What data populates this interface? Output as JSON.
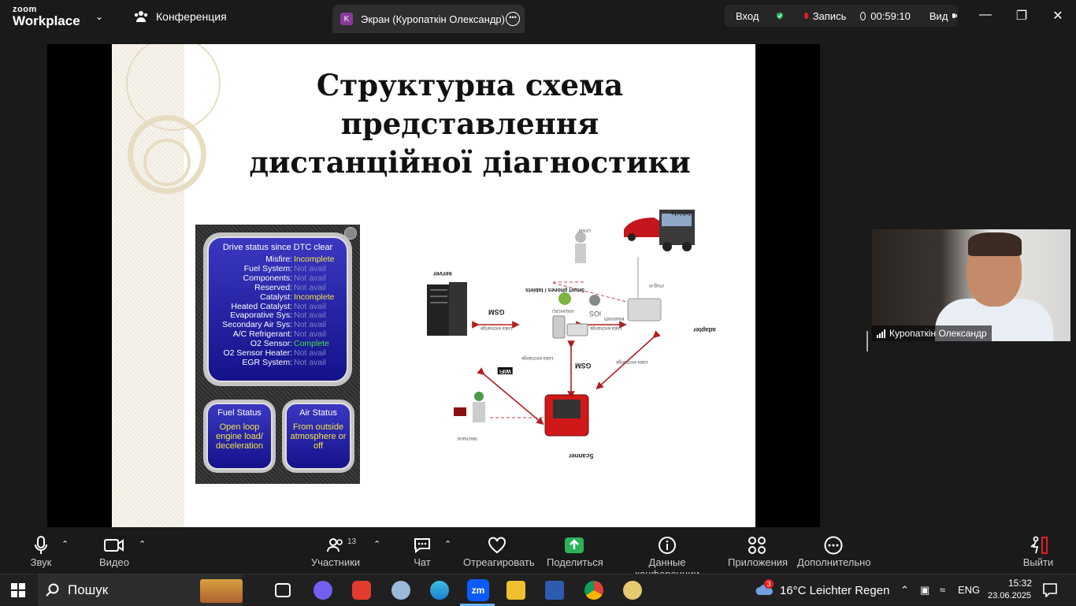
{
  "app": {
    "logo_top": "zoom",
    "logo_bottom": "Workplace"
  },
  "header": {
    "conference_label": "Конференция",
    "screen_tab": {
      "badge": "K",
      "label": "Экран (Куропаткін Олександр)"
    },
    "login": "Вход",
    "record": "Запись",
    "timer": "00:59:10",
    "view": "Вид"
  },
  "slide": {
    "title_line1": "Структурна схема представлення",
    "title_line2": "дистанційної діагностики",
    "obd": {
      "header": "Drive status since DTC clear",
      "rows": [
        {
          "key": "Misfire:",
          "value": "Incomplete"
        },
        {
          "key": "Fuel System:",
          "value": "Not avail"
        },
        {
          "key": "Components:",
          "value": "Not avail"
        },
        {
          "key": "Reserved:",
          "value": "Not avail"
        },
        {
          "key": "Catalyst:",
          "value": "Incomplete"
        },
        {
          "key": "Heated Catalyst:",
          "value": "Not avail"
        },
        {
          "key": "Evaporative Sys:",
          "value": "Not avail"
        },
        {
          "key": "Secondary Air Sys:",
          "value": "Not avail"
        },
        {
          "key": "A/C Refrigerant:",
          "value": "Not avail"
        },
        {
          "key": "O2 Sensor:",
          "value": "Complete"
        },
        {
          "key": "O2 Sensor Heater:",
          "value": "Not avail"
        },
        {
          "key": "EGR System:",
          "value": "Not avail"
        }
      ],
      "fuel_status": {
        "title": "Fuel Status",
        "line1": "Open loop",
        "line2": "engine load/",
        "line3": "deceleration"
      },
      "air_status": {
        "title": "Air Status",
        "line1": "From outside",
        "line2": "atmosphere or",
        "line3": "off"
      }
    },
    "diagram": {
      "server": "server",
      "smartphones": "Smart phones / tablets",
      "vehicle": "Vehicle",
      "driver": "Driver",
      "adapter": "adapter",
      "scanner": "Scanner",
      "mechanic": "Mechanic",
      "plug_in": "Plug-in",
      "gsm": "GSM",
      "wifi": "WiFi",
      "bluetooth": "Bluetooth",
      "data_exchange": "Data exchange",
      "android": "ANDROID",
      "ios": "iOS"
    }
  },
  "video": {
    "name": "Куропаткін Олександр"
  },
  "toolbar": {
    "audio": "Звук",
    "video": "Видео",
    "participants": "Участники",
    "participants_count": "13",
    "chat": "Чат",
    "react": "Отреагировать",
    "share": "Поделиться",
    "info": "Данные конференции",
    "apps": "Приложения",
    "more": "Дополнительно",
    "leave": "Выйти"
  },
  "taskbar": {
    "search": "Пошук",
    "weather_badge": "3",
    "weather": "16°C  Leichter Regen",
    "lang": "ENG",
    "time": "15:32",
    "date": "23.06.2025"
  },
  "colors": {
    "share_green": "#2bb35a",
    "record_red": "#e02020",
    "zoom_blue": "#0b5cff"
  }
}
